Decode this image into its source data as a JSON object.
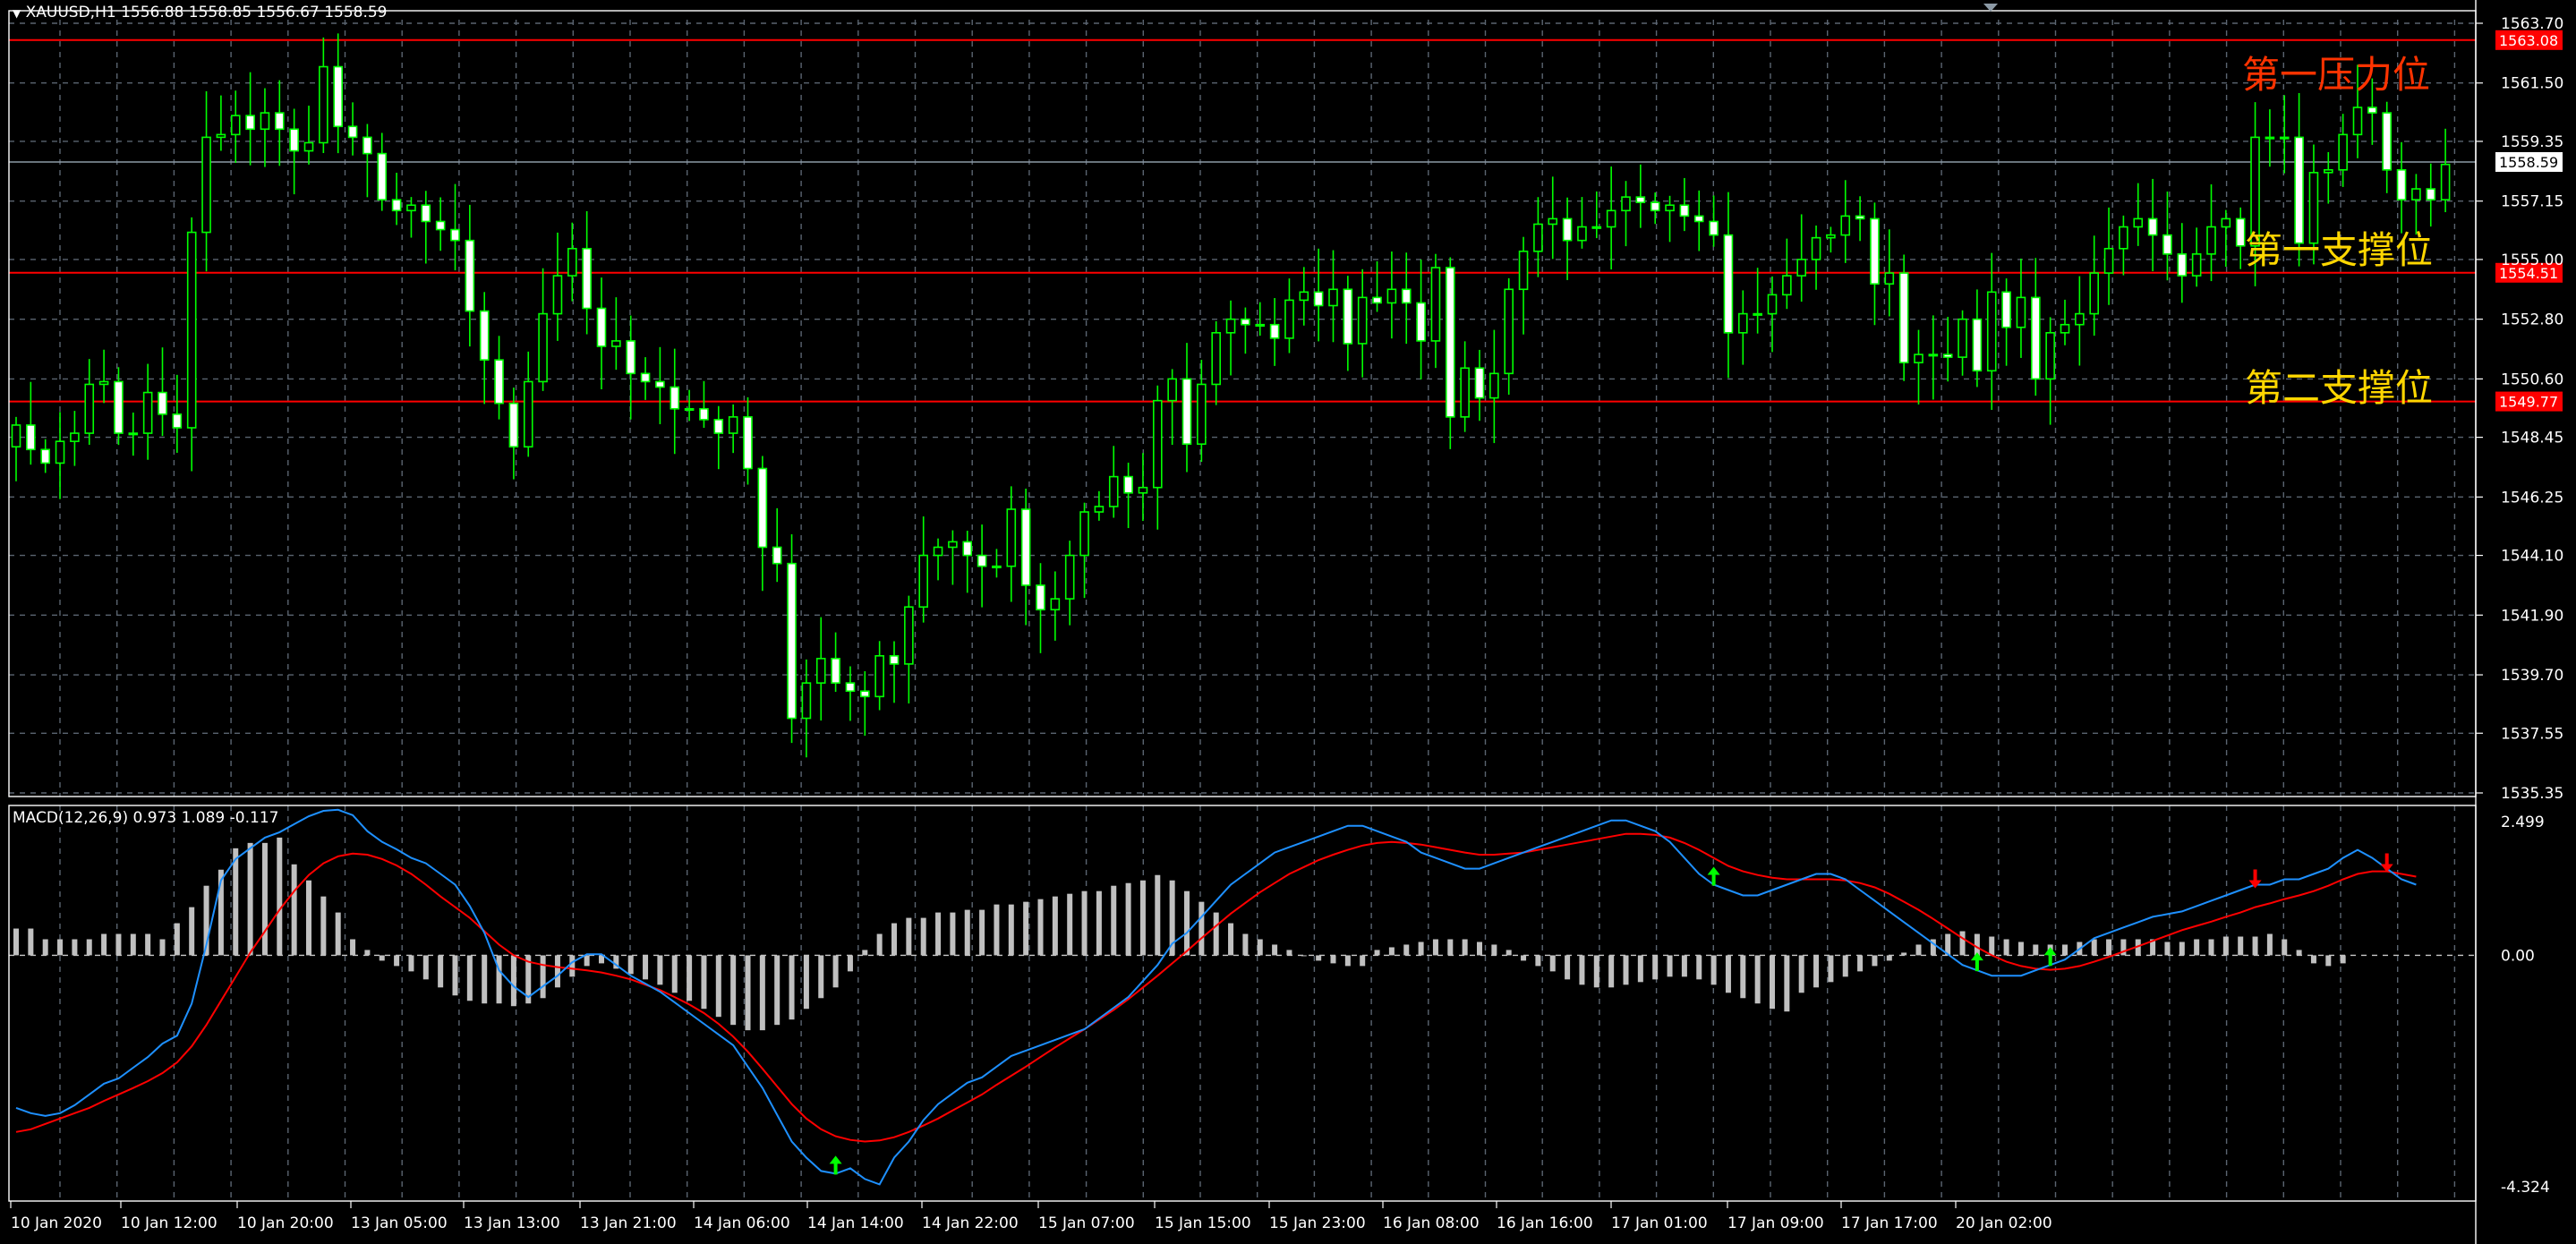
{
  "header": {
    "symbol_info": "XAUUSD,H1  1556.88 1558.85 1556.67 1558.59",
    "macd_info": "MACD(12,26,9) 0.973 1.089 -0.117"
  },
  "colors": {
    "background": "#000000",
    "grid": "#5a6470",
    "bull_candle": "#00ff00",
    "level_line": "#ff0000",
    "label_red": "#ff3300",
    "label_yellow": "#ffd700",
    "macd_main": "#1e90ff",
    "macd_signal": "#ff0000",
    "histogram": "#c0c0c0",
    "buy_arrow": "#00ff00",
    "sell_arrow": "#ff0000"
  },
  "levels": [
    {
      "name": "第一压力位",
      "price": 1563.08,
      "label": "1563.08",
      "text_color": "#ff3300"
    },
    {
      "name": "第一支撑位",
      "price": 1554.51,
      "label": "1554.51",
      "text_color": "#ffd700"
    },
    {
      "name": "第二支撑位",
      "price": 1549.77,
      "label": "1549.77",
      "text_color": "#ffd700"
    }
  ],
  "chart_data": [
    {
      "type": "candlestick",
      "title": "XAUUSD,H1",
      "current_price": 1558.59,
      "ylim": [
        1535.35,
        1563.7
      ],
      "y_ticks": [
        "1563.70",
        "1561.50",
        "1559.35",
        "1557.15",
        "1555.00",
        "1552.80",
        "1550.60",
        "1548.45",
        "1546.25",
        "1544.10",
        "1541.90",
        "1539.70",
        "1537.55",
        "1535.35"
      ],
      "x_ticks": [
        "10 Jan 2020",
        "10 Jan 12:00",
        "10 Jan 20:00",
        "13 Jan 05:00",
        "13 Jan 13:00",
        "13 Jan 21:00",
        "14 Jan 06:00",
        "14 Jan 14:00",
        "14 Jan 22:00",
        "15 Jan 07:00",
        "15 Jan 15:00",
        "15 Jan 23:00",
        "16 Jan 08:00",
        "16 Jan 16:00",
        "17 Jan 01:00",
        "17 Jan 09:00",
        "17 Jan 17:00",
        "20 Jan 02:00"
      ],
      "close": [
        1548.9,
        1548.0,
        1547.5,
        1548.3,
        1548.6,
        1550.4,
        1550.5,
        1548.6,
        1548.6,
        1550.1,
        1549.3,
        1548.8,
        1556.0,
        1559.5,
        1559.6,
        1560.3,
        1559.8,
        1560.4,
        1559.8,
        1559.0,
        1559.3,
        1562.1,
        1559.9,
        1559.5,
        1558.9,
        1557.2,
        1556.8,
        1557.0,
        1556.4,
        1556.1,
        1555.7,
        1553.1,
        1551.3,
        1549.7,
        1548.1,
        1550.5,
        1553.0,
        1554.4,
        1555.4,
        1553.2,
        1551.8,
        1552.0,
        1550.8,
        1550.5,
        1550.3,
        1549.5,
        1549.5,
        1549.1,
        1548.6,
        1549.2,
        1547.3,
        1544.4,
        1543.8,
        1538.1,
        1539.4,
        1540.3,
        1539.4,
        1539.1,
        1538.9,
        1540.4,
        1540.1,
        1542.2,
        1544.1,
        1544.4,
        1544.6,
        1544.1,
        1543.7,
        1543.7,
        1545.8,
        1543.0,
        1542.1,
        1542.5,
        1544.1,
        1545.7,
        1545.9,
        1547.0,
        1546.4,
        1546.6,
        1549.8,
        1550.6,
        1548.2,
        1550.4,
        1552.3,
        1552.8,
        1552.6,
        1552.6,
        1552.1,
        1553.5,
        1553.8,
        1553.3,
        1553.9,
        1551.9,
        1553.6,
        1553.4,
        1553.9,
        1553.4,
        1552.0,
        1554.7,
        1549.2,
        1551.0,
        1549.9,
        1550.8,
        1553.9,
        1555.3,
        1556.3,
        1556.5,
        1555.7,
        1556.2,
        1556.2,
        1556.8,
        1557.3,
        1557.1,
        1556.8,
        1557.0,
        1556.6,
        1556.4,
        1555.9,
        1552.3,
        1553.0,
        1553.0,
        1553.7,
        1554.4,
        1555.0,
        1555.8,
        1555.9,
        1556.6,
        1556.5,
        1554.1,
        1554.5,
        1551.2,
        1551.5,
        1551.5,
        1551.4,
        1552.8,
        1550.9,
        1553.8,
        1552.5,
        1553.6,
        1550.6,
        1552.3,
        1552.6,
        1553.0,
        1554.5,
        1555.4,
        1556.2,
        1556.5,
        1555.9,
        1555.2,
        1554.4,
        1555.2,
        1556.2,
        1556.5,
        1555.5,
        1559.5,
        1559.5,
        1559.5,
        1555.6,
        1558.2,
        1558.3,
        1559.6,
        1560.6,
        1560.4,
        1558.3,
        1557.2,
        1557.6,
        1557.2,
        1558.5
      ]
    },
    {
      "type": "line",
      "title": "MACD(12,26,9)",
      "values_header": [
        0.973,
        1.089,
        -0.117
      ],
      "ylim": [
        -4.324,
        2.499
      ],
      "y_ticks": [
        "2.499",
        "0.00",
        "-4.324"
      ],
      "series": [
        {
          "name": "MACD",
          "values": [
            -2.85,
            -2.95,
            -3.0,
            -2.95,
            -2.8,
            -2.6,
            -2.4,
            -2.3,
            -2.1,
            -1.9,
            -1.65,
            -1.5,
            -0.9,
            0.2,
            1.4,
            1.8,
            2.0,
            2.2,
            2.3,
            2.45,
            2.6,
            2.7,
            2.72,
            2.62,
            2.32,
            2.12,
            1.98,
            1.82,
            1.72,
            1.52,
            1.32,
            0.92,
            0.42,
            -0.28,
            -0.58,
            -0.78,
            -0.58,
            -0.38,
            -0.13,
            0.02,
            0.02,
            -0.18,
            -0.38,
            -0.53,
            -0.68,
            -0.88,
            -1.08,
            -1.28,
            -1.48,
            -1.68,
            -2.08,
            -2.48,
            -2.98,
            -3.48,
            -3.78,
            -4.03,
            -4.08,
            -3.98,
            -4.18,
            -4.28,
            -3.78,
            -3.48,
            -3.08,
            -2.78,
            -2.58,
            -2.38,
            -2.28,
            -2.08,
            -1.88,
            -1.78,
            -1.68,
            -1.58,
            -1.48,
            -1.38,
            -1.18,
            -0.98,
            -0.78,
            -0.48,
            -0.18,
            0.22,
            0.42,
            0.72,
            1.02,
            1.32,
            1.52,
            1.72,
            1.92,
            2.02,
            2.12,
            2.22,
            2.32,
            2.42,
            2.42,
            2.32,
            2.22,
            2.12,
            1.92,
            1.82,
            1.72,
            1.62,
            1.62,
            1.72,
            1.82,
            1.92,
            2.02,
            2.12,
            2.22,
            2.32,
            2.42,
            2.52,
            2.52,
            2.42,
            2.32,
            2.12,
            1.82,
            1.52,
            1.32,
            1.22,
            1.12,
            1.12,
            1.22,
            1.32,
            1.42,
            1.52,
            1.52,
            1.42,
            1.22,
            1.02,
            0.82,
            0.62,
            0.42,
            0.22,
            0.02,
            -0.18,
            -0.28,
            -0.38,
            -0.38,
            -0.38,
            -0.28,
            -0.18,
            -0.08,
            0.12,
            0.32,
            0.42,
            0.52,
            0.62,
            0.72,
            0.77,
            0.82,
            0.92,
            1.02,
            1.12,
            1.22,
            1.32,
            1.32,
            1.42,
            1.42,
            1.52,
            1.62,
            1.82,
            1.97,
            1.82,
            1.62,
            1.42,
            1.32
          ]
        },
        {
          "name": "Signal",
          "values": [
            -3.3,
            -3.25,
            -3.15,
            -3.05,
            -2.95,
            -2.85,
            -2.72,
            -2.6,
            -2.48,
            -2.35,
            -2.2,
            -2.0,
            -1.7,
            -1.3,
            -0.85,
            -0.4,
            0.05,
            0.45,
            0.85,
            1.2,
            1.5,
            1.72,
            1.85,
            1.9,
            1.88,
            1.8,
            1.68,
            1.52,
            1.32,
            1.1,
            0.9,
            0.7,
            0.45,
            0.2,
            0.0,
            -0.12,
            -0.18,
            -0.22,
            -0.25,
            -0.28,
            -0.32,
            -0.38,
            -0.45,
            -0.55,
            -0.65,
            -0.78,
            -0.92,
            -1.08,
            -1.28,
            -1.52,
            -1.8,
            -2.12,
            -2.45,
            -2.78,
            -3.05,
            -3.25,
            -3.38,
            -3.45,
            -3.48,
            -3.46,
            -3.4,
            -3.3,
            -3.18,
            -3.05,
            -2.9,
            -2.75,
            -2.6,
            -2.42,
            -2.25,
            -2.08,
            -1.9,
            -1.72,
            -1.55,
            -1.38,
            -1.2,
            -1.02,
            -0.82,
            -0.6,
            -0.38,
            -0.15,
            0.08,
            0.32,
            0.55,
            0.78,
            0.98,
            1.18,
            1.35,
            1.52,
            1.65,
            1.78,
            1.88,
            1.97,
            2.05,
            2.1,
            2.12,
            2.1,
            2.07,
            2.02,
            1.97,
            1.92,
            1.88,
            1.88,
            1.9,
            1.92,
            1.97,
            2.02,
            2.07,
            2.12,
            2.17,
            2.22,
            2.27,
            2.27,
            2.25,
            2.2,
            2.1,
            1.97,
            1.82,
            1.67,
            1.57,
            1.5,
            1.45,
            1.42,
            1.42,
            1.42,
            1.42,
            1.4,
            1.35,
            1.27,
            1.15,
            1.0,
            0.85,
            0.68,
            0.5,
            0.32,
            0.15,
            0.0,
            -0.12,
            -0.2,
            -0.25,
            -0.27,
            -0.25,
            -0.2,
            -0.12,
            -0.03,
            0.07,
            0.17,
            0.27,
            0.37,
            0.47,
            0.55,
            0.63,
            0.72,
            0.8,
            0.9,
            0.97,
            1.05,
            1.12,
            1.2,
            1.3,
            1.42,
            1.52,
            1.57,
            1.57,
            1.52,
            1.47
          ]
        },
        {
          "name": "Histogram",
          "values": [
            0.5,
            0.5,
            0.3,
            0.3,
            0.3,
            0.3,
            0.4,
            0.4,
            0.4,
            0.4,
            0.3,
            0.6,
            0.9,
            1.3,
            1.6,
            2.0,
            2.1,
            2.1,
            2.2,
            1.7,
            1.4,
            1.1,
            0.8,
            0.3,
            0.1,
            -0.1,
            -0.2,
            -0.3,
            -0.45,
            -0.6,
            -0.75,
            -0.85,
            -0.9,
            -0.9,
            -0.95,
            -0.9,
            -0.8,
            -0.6,
            -0.4,
            -0.2,
            -0.15,
            -0.25,
            -0.35,
            -0.45,
            -0.55,
            -0.7,
            -0.85,
            -1.0,
            -1.15,
            -1.3,
            -1.4,
            -1.4,
            -1.3,
            -1.2,
            -1.0,
            -0.8,
            -0.6,
            -0.3,
            0.1,
            0.4,
            0.6,
            0.7,
            0.7,
            0.8,
            0.8,
            0.85,
            0.85,
            0.95,
            0.95,
            1.0,
            1.05,
            1.1,
            1.15,
            1.2,
            1.2,
            1.3,
            1.35,
            1.4,
            1.5,
            1.4,
            1.2,
            1.0,
            0.8,
            0.6,
            0.4,
            0.3,
            0.2,
            0.1,
            0.0,
            -0.1,
            -0.15,
            -0.2,
            -0.2,
            0.1,
            0.15,
            0.2,
            0.25,
            0.3,
            0.3,
            0.3,
            0.25,
            0.2,
            0.1,
            -0.1,
            -0.2,
            -0.3,
            -0.45,
            -0.55,
            -0.6,
            -0.6,
            -0.55,
            -0.5,
            -0.45,
            -0.4,
            -0.4,
            -0.45,
            -0.55,
            -0.7,
            -0.8,
            -0.9,
            -1.0,
            -1.05,
            -0.7,
            -0.6,
            -0.5,
            -0.4,
            -0.3,
            -0.2,
            -0.1,
            0.05,
            0.2,
            0.3,
            0.4,
            0.45,
            0.4,
            0.35,
            0.3,
            0.25,
            0.2,
            0.2,
            0.2,
            0.25,
            0.3,
            0.3,
            0.3,
            0.3,
            0.3,
            0.25,
            0.25,
            0.3,
            0.3,
            0.35,
            0.35,
            0.35,
            0.4,
            0.3,
            0.1,
            -0.15,
            -0.2,
            -0.15
          ]
        }
      ],
      "arrows": [
        {
          "index": 56,
          "dir": "up"
        },
        {
          "index": 116,
          "dir": "up"
        },
        {
          "index": 134,
          "dir": "up"
        },
        {
          "index": 139,
          "dir": "up"
        },
        {
          "index": 153,
          "dir": "down"
        },
        {
          "index": 162,
          "dir": "down"
        }
      ]
    }
  ]
}
